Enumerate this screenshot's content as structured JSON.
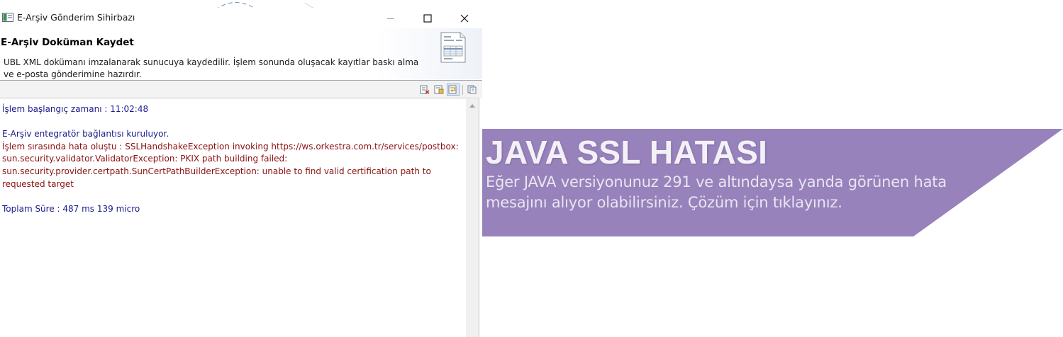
{
  "window": {
    "title": "E-Arşiv Gönderim Sihirbazı",
    "controls": {
      "minimize_icon": "minimize-icon",
      "maximize_icon": "maximize-icon",
      "close_icon": "close-icon"
    }
  },
  "header": {
    "title": "E-Arşiv Doküman Kaydet",
    "description": "UBL XML dokümanı imzalanarak sunucuya kaydedilir. İşlem sonunda oluşacak kayıtlar baskı alma ve e-posta gönderimine hazırdır.",
    "icon": "document-form-icon"
  },
  "toolbar": {
    "buttons": [
      {
        "icon": "clear-console-icon",
        "active": false
      },
      {
        "icon": "scroll-lock-icon",
        "active": false
      },
      {
        "icon": "word-wrap-icon",
        "active": true
      },
      {
        "icon": "copy-icon",
        "active": false
      }
    ]
  },
  "console": {
    "lines": [
      {
        "text": "İşlem başlangıç zamanı : 11:02:48",
        "kind": "info"
      },
      {
        "text": "",
        "kind": "blank"
      },
      {
        "text": "E-Arşiv entegratör bağlantısı kuruluyor.",
        "kind": "info"
      },
      {
        "text": "İşlem sırasında hata oluştu : SSLHandshakeException invoking https://ws.orkestra.com.tr/services/postbox: sun.security.validator.ValidatorException: PKIX path building failed: sun.security.provider.certpath.SunCertPathBuilderException: unable to find valid certification path to requested target",
        "kind": "error"
      },
      {
        "text": "",
        "kind": "blank"
      },
      {
        "text": "Toplam Süre : 487 ms 139 micro",
        "kind": "info"
      }
    ]
  },
  "banner": {
    "title": "JAVA SSL HATASI",
    "description": "Eğer JAVA versiyonunuz 291 ve altındaysa yanda görünen hata mesajını alıyor olabilirsiniz. Çözüm için tıklayınız.",
    "background_color": "#9782bb"
  },
  "colors": {
    "console_info": "#1a1a8c",
    "console_error": "#8b1010"
  }
}
